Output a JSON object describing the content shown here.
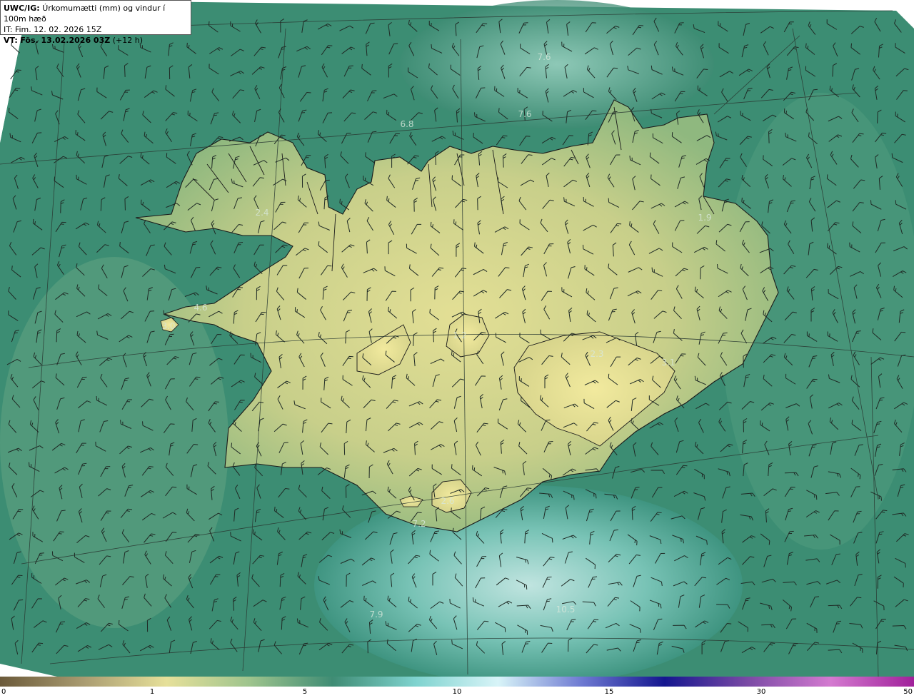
{
  "header": {
    "product": "UWC/IG:",
    "title": "Úrkomumætti (mm) og vindur í 100m hæð",
    "issue_time": "IT: Fim. 12. 02. 2026 15Z",
    "valid_prefix": "VT:",
    "valid_time": "Fös. 13.02.2026 03Z",
    "valid_offset": "(+12 h)"
  },
  "map_values": [
    "7.6",
    "7.6",
    "6.8",
    "2.4",
    "4.6",
    "3.0",
    "1.2",
    "7.2",
    "7.9",
    "10.5",
    "2.6",
    "3.1",
    "1.9",
    "2.3"
  ],
  "colorbar": {
    "ticks": [
      "0",
      "1",
      "5",
      "10",
      "15",
      "30",
      "50"
    ],
    "colors": [
      "#6b5a3a",
      "#a99b70",
      "#e6e09a",
      "#9ec48d",
      "#3f8c74",
      "#7fd3cf",
      "#d8f4f8",
      "#6e7ad2",
      "#15168f",
      "#7a4aa5",
      "#d47ad0",
      "#a0209a"
    ]
  },
  "icons": [
    "wind-barb-icon"
  ]
}
